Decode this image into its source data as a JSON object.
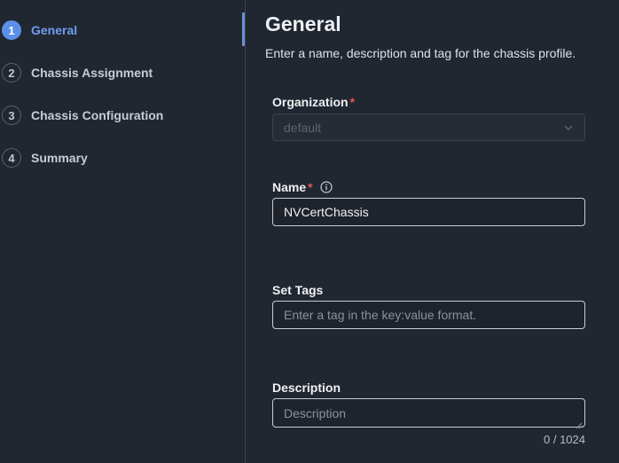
{
  "steps": [
    {
      "number": "1",
      "label": "General",
      "active": true
    },
    {
      "number": "2",
      "label": "Chassis Assignment",
      "active": false
    },
    {
      "number": "3",
      "label": "Chassis Configuration",
      "active": false
    },
    {
      "number": "4",
      "label": "Summary",
      "active": false
    }
  ],
  "main": {
    "title": "General",
    "subtitle": "Enter a name, description and tag for the chassis profile."
  },
  "organization": {
    "label": "Organization",
    "required_mark": "*",
    "value": "default",
    "disabled": true
  },
  "name": {
    "label": "Name",
    "required_mark": "*",
    "value": "NVCertChassis",
    "icon": "info-icon"
  },
  "tags": {
    "label": "Set Tags",
    "placeholder": "Enter a tag in the key:value format."
  },
  "description": {
    "label": "Description",
    "placeholder": "Description",
    "char_count": "0 / 1024"
  },
  "colors": {
    "background": "#212730",
    "accent": "#5b8fe8",
    "required": "#e0554f"
  }
}
